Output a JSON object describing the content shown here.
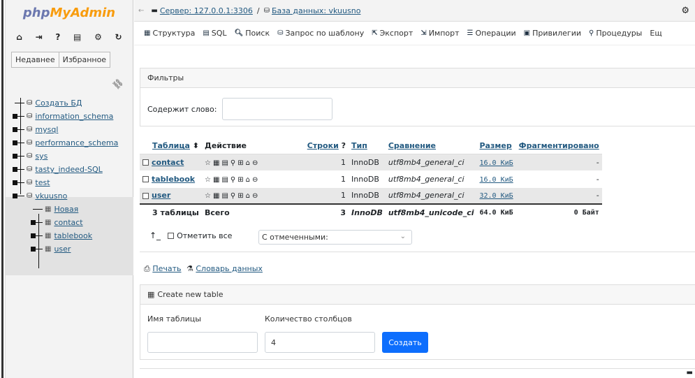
{
  "sidebar": {
    "logo_part1": "php",
    "logo_part2": "MyAdmin",
    "tabs": [
      "Недавнее",
      "Избранное"
    ],
    "tree": [
      {
        "label": "Создать БД",
        "kind": "new"
      },
      {
        "label": "information_schema",
        "kind": "db"
      },
      {
        "label": "mysql",
        "kind": "db"
      },
      {
        "label": "performance_schema",
        "kind": "db"
      },
      {
        "label": "sys",
        "kind": "db"
      },
      {
        "label": "tasty_indeed-SQL",
        "kind": "db"
      },
      {
        "label": "test",
        "kind": "db"
      },
      {
        "label": "vkuusno",
        "kind": "db"
      }
    ],
    "subtree": [
      "Новая",
      "contact",
      "tablebook",
      "user"
    ]
  },
  "topbar": {
    "server": "Сервер: 127.0.0.1:3306",
    "separator": "/",
    "database": "База данных: vkuusno"
  },
  "menu": [
    "Структура",
    "SQL",
    "Поиск",
    "Запрос по шаблону",
    "Экспорт",
    "Импорт",
    "Операции",
    "Привилегии",
    "Процедуры",
    "Ещ"
  ],
  "filters": {
    "title": "Фильтры",
    "label": "Содержит слово:",
    "value": ""
  },
  "table": {
    "headers": {
      "name": "Таблица",
      "action": "Действие",
      "rows": "Строки",
      "type": "Тип",
      "collation": "Сравнение",
      "size": "Размер",
      "overhead": "Фрагментировано"
    },
    "rows": [
      {
        "name": "contact",
        "rows": "1",
        "type": "InnoDB",
        "collation": "utf8mb4_general_ci",
        "size": "16.0 КиБ",
        "overhead": "-"
      },
      {
        "name": "tablebook",
        "rows": "1",
        "type": "InnoDB",
        "collation": "utf8mb4_general_ci",
        "size": "16.0 КиБ",
        "overhead": "-"
      },
      {
        "name": "user",
        "rows": "1",
        "type": "InnoDB",
        "collation": "utf8mb4_general_ci",
        "size": "32.0 КиБ",
        "overhead": "-"
      }
    ],
    "total": {
      "name": "3 таблицы",
      "label": "Всего",
      "rows": "3",
      "type": "InnoDB",
      "collation": "utf8mb4_unicode_ci",
      "size": "64.0 КиБ",
      "overhead": "0 Байт"
    }
  },
  "bulk": {
    "check_all": "Отметить все",
    "with_selected": "С отмеченными:"
  },
  "links": {
    "print": "Печать",
    "dictionary": "Словарь данных"
  },
  "create": {
    "title": "Create new table",
    "name_label": "Имя таблицы",
    "name_value": "",
    "cols_label": "Количество столбцов",
    "cols_value": "4",
    "button": "Создать"
  }
}
